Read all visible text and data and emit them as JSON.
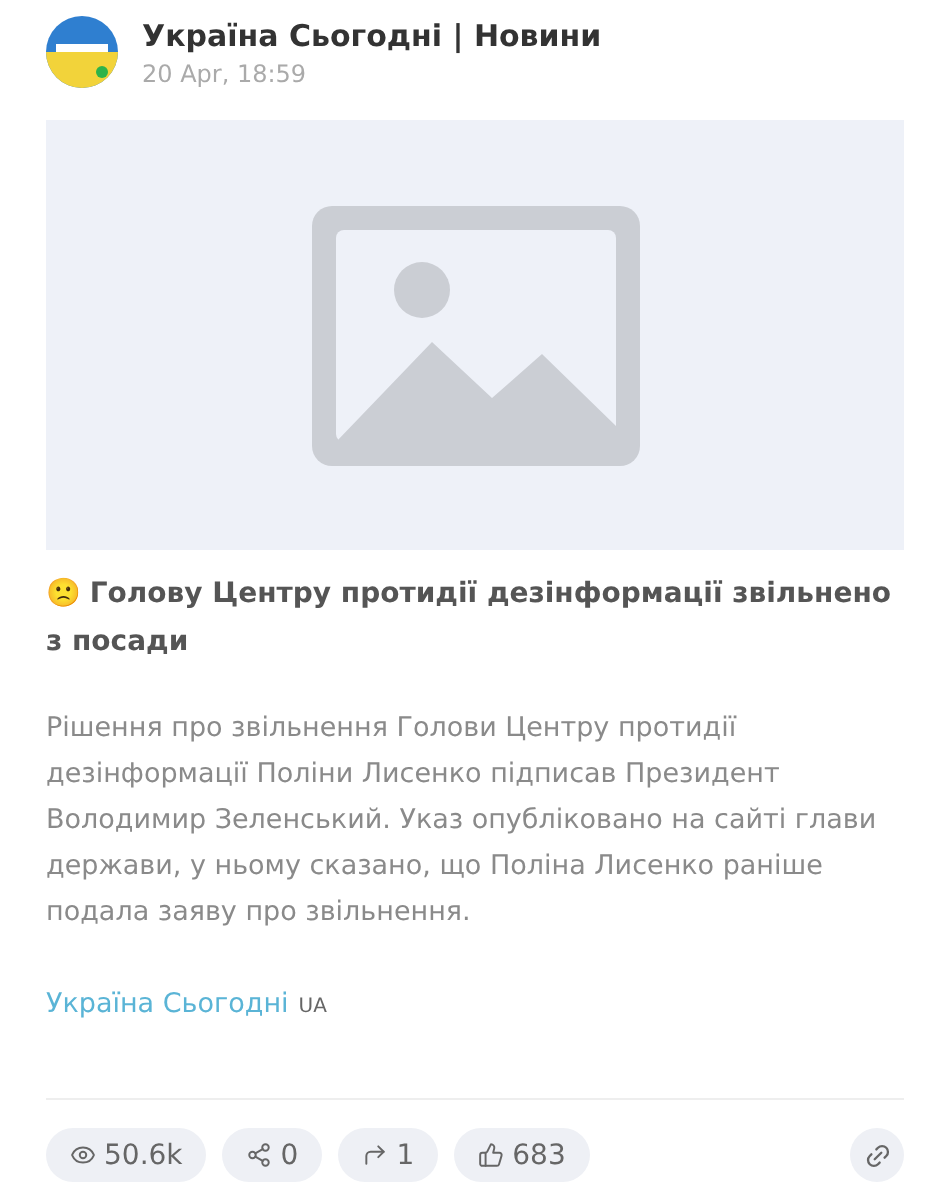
{
  "channel": {
    "name": "Україна Сьогодні | Новини",
    "date": "20 Apr, 18:59"
  },
  "post": {
    "title": "🙁 Голову Центру протидії дезінформації звільнено з посади",
    "body": "Рішення про звільнення Голови Центру протидії дезінформації Поліни Лисенко підписав Президент Володимир Зеленський. Указ опубліковано на сайті глави держави, у ньому сказано, що Поліна Лисенко раніше подала заяву про звільнення.",
    "source_link": "Україна Сьогодні",
    "source_suffix": "UA"
  },
  "actions": [
    {
      "kind": "views",
      "label": "50.6k"
    },
    {
      "kind": "shares",
      "label": "0"
    },
    {
      "kind": "forwards",
      "label": "1"
    },
    {
      "kind": "likes",
      "label": "683"
    }
  ]
}
